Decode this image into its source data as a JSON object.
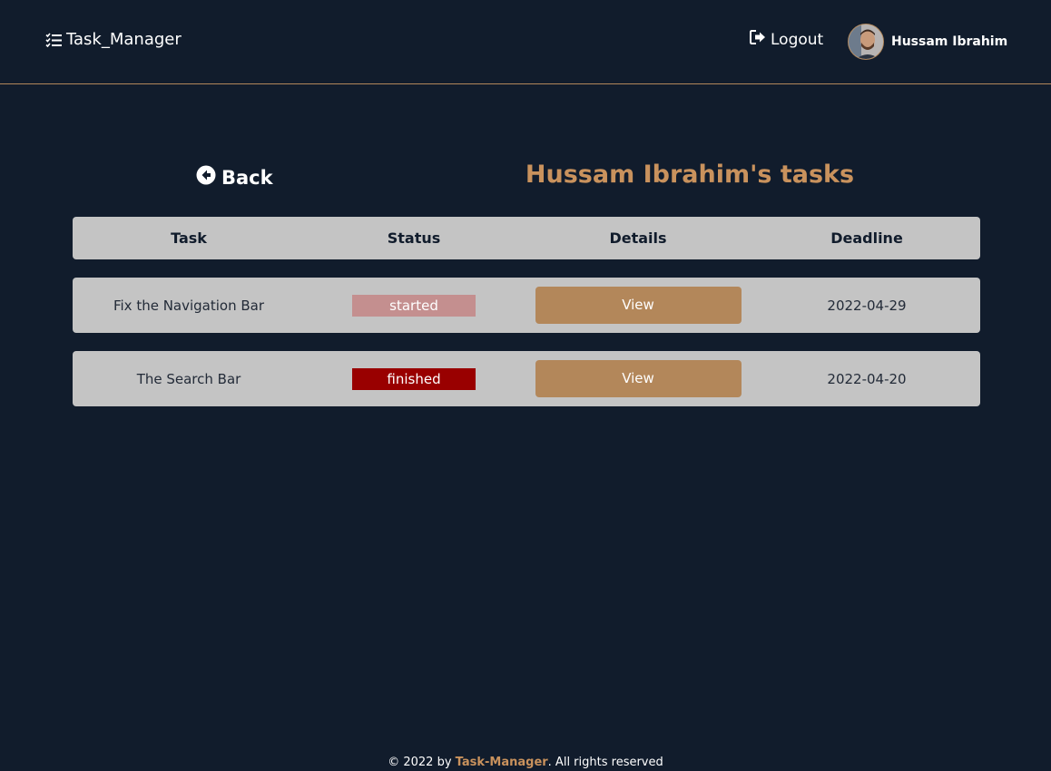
{
  "header": {
    "brand": "Task_Manager",
    "logout_label": "Logout",
    "user_name": "Hussam Ibrahim"
  },
  "title_row": {
    "back_label": "Back",
    "page_title": "Hussam Ibrahim's tasks"
  },
  "table": {
    "columns": [
      "Task",
      "Status",
      "Details",
      "Deadline"
    ],
    "rows": [
      {
        "task": "Fix the Navigation Bar",
        "status": "started",
        "details": "View",
        "deadline": "2022-04-29"
      },
      {
        "task": "The Search Bar",
        "status": "finished",
        "details": "View",
        "deadline": "2022-04-20"
      }
    ]
  },
  "footer": {
    "prefix": "© 2022 by ",
    "brand": "Task-Manager",
    "suffix": ". All rights reserved"
  },
  "colors": {
    "background": "#111c2c",
    "accent": "#b3875a",
    "title": "#c9925d",
    "status_started": "#c48f8f",
    "status_finished": "#990000",
    "row_bg": "#c4c4c4"
  },
  "icons": {
    "brand": "checklist-icon",
    "logout": "logout-icon",
    "back": "arrow-left-circle-icon"
  }
}
